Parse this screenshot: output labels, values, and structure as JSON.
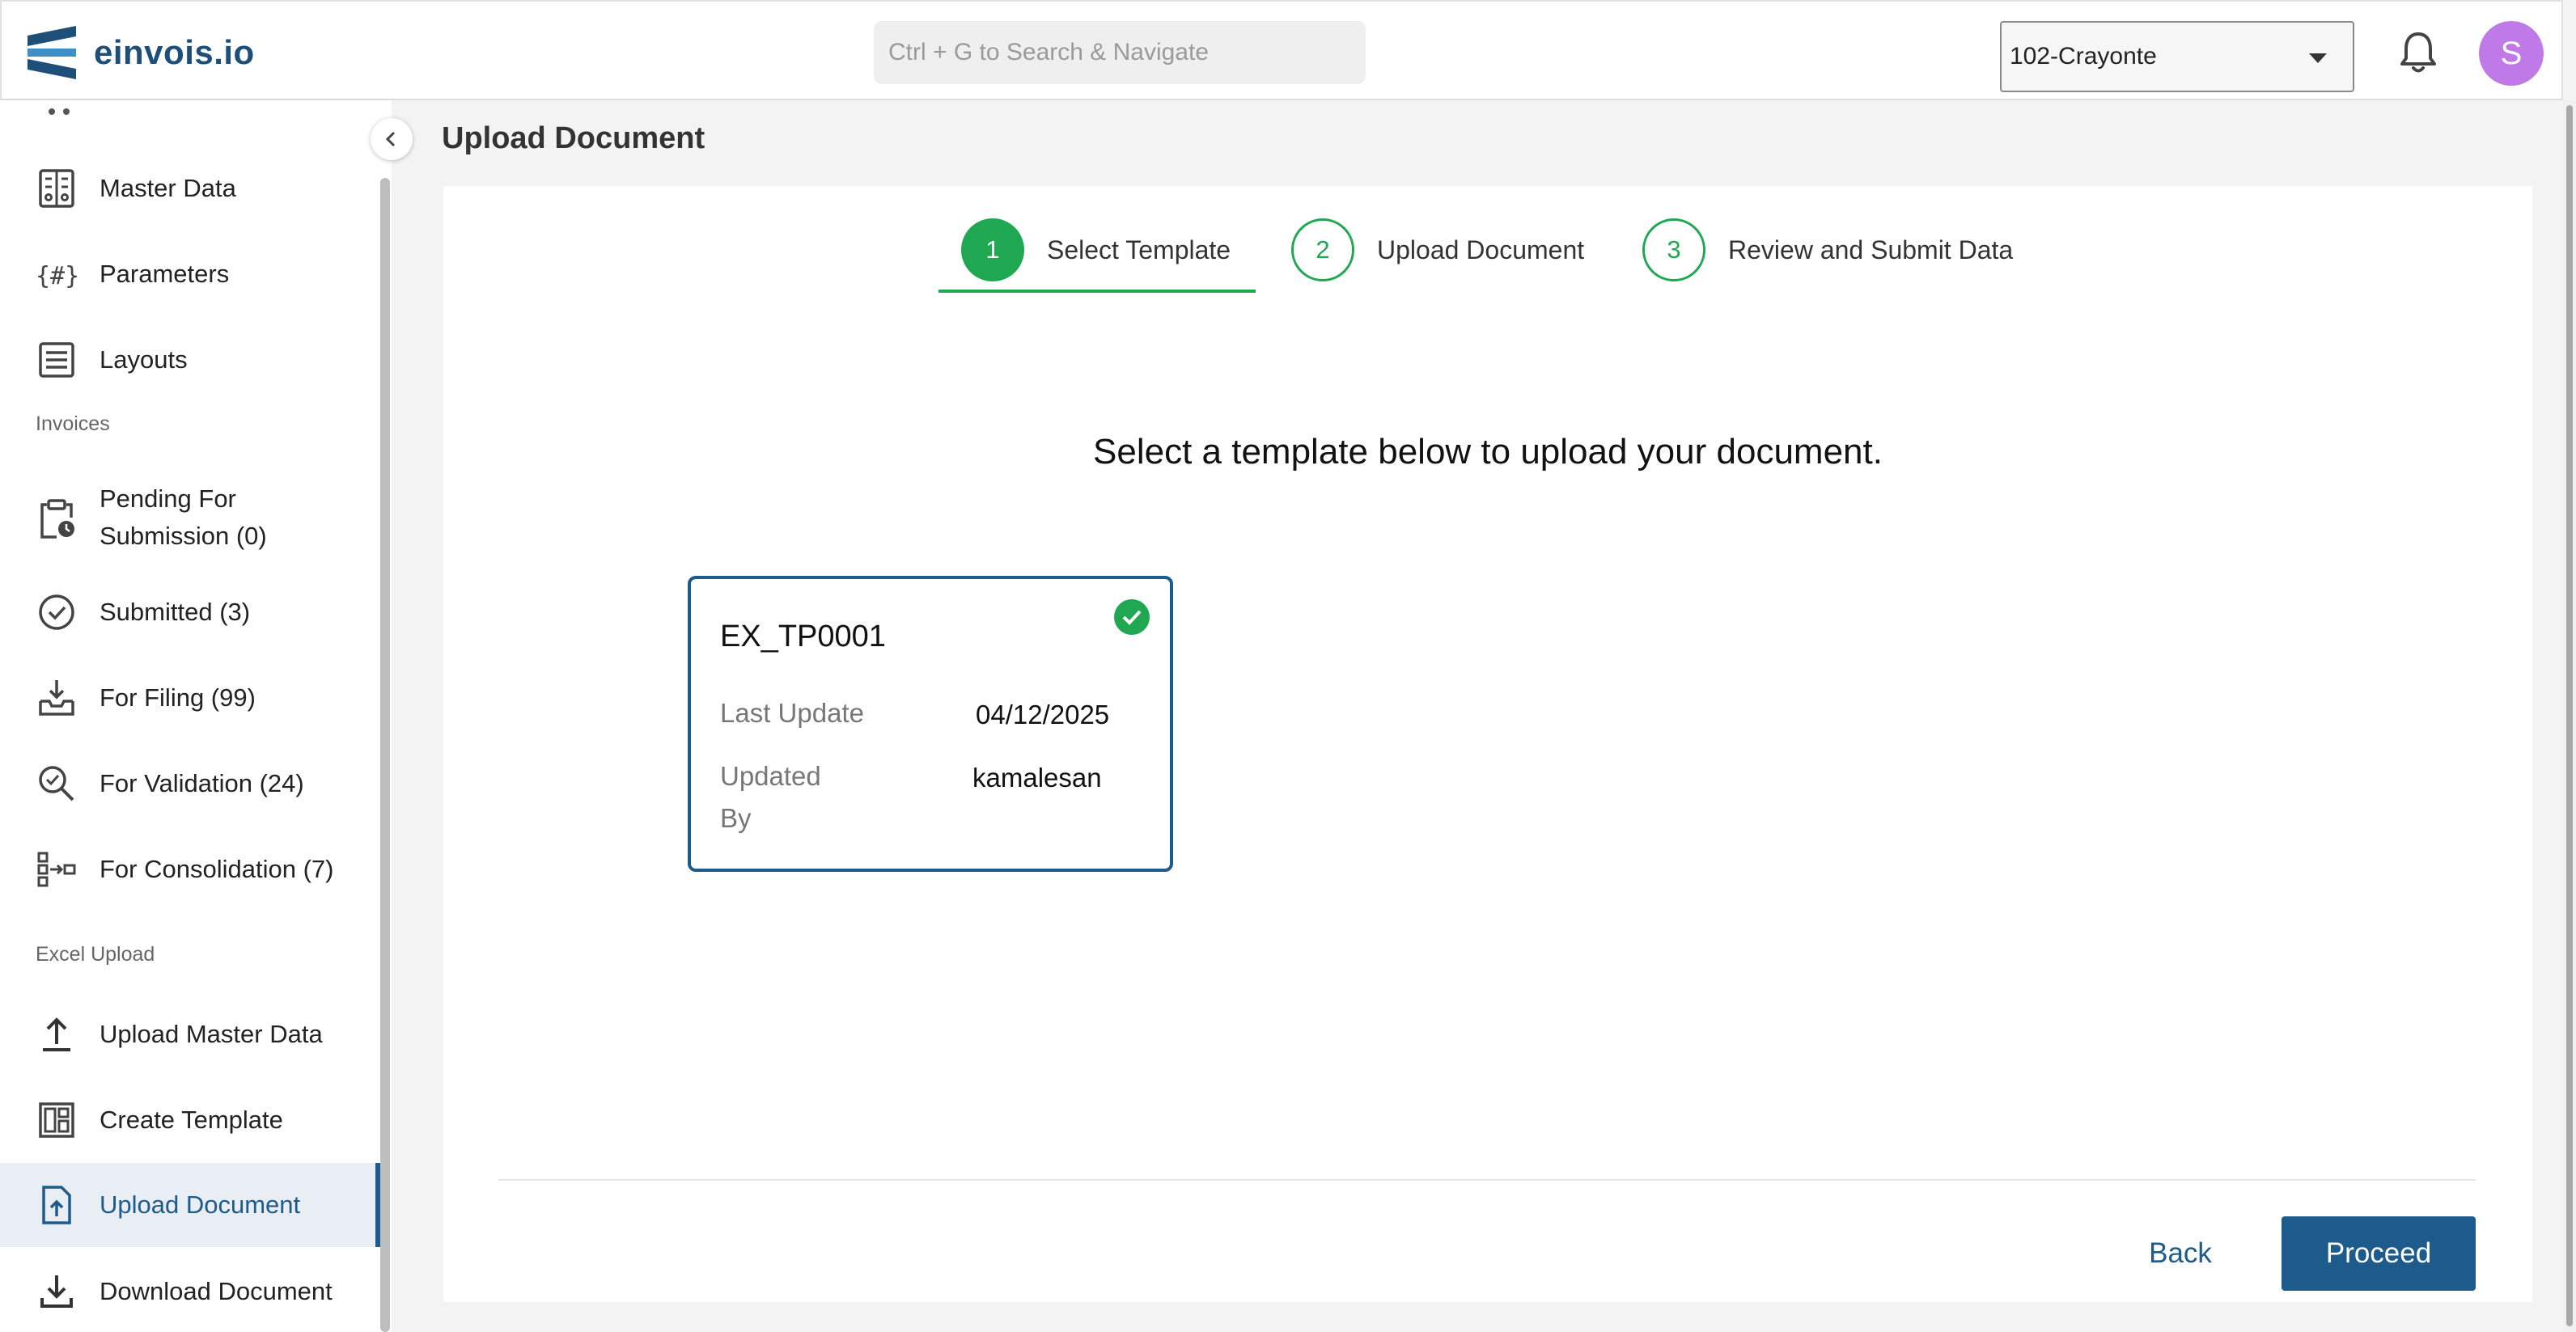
{
  "app": {
    "name": "einvois.io"
  },
  "header": {
    "search_placeholder": "Ctrl + G to Search & Navigate",
    "company_selected": "102-Crayonte",
    "avatar_initial": "S"
  },
  "sidebar": {
    "items_top": [
      {
        "label": "Master Data",
        "icon": "master-data-icon"
      },
      {
        "label": "Parameters",
        "icon": "parameters-icon"
      },
      {
        "label": "Layouts",
        "icon": "layouts-icon"
      }
    ],
    "section_invoices": "Invoices",
    "invoice_items": [
      {
        "label": "Pending For Submission (0)",
        "icon": "pending-clipboard-icon"
      },
      {
        "label": "Submitted (3)",
        "icon": "check-circle-icon"
      },
      {
        "label": "For Filing (99)",
        "icon": "inbox-download-icon"
      },
      {
        "label": "For Validation (24)",
        "icon": "magnify-check-icon"
      },
      {
        "label": "For Consolidation (7)",
        "icon": "consolidation-icon"
      }
    ],
    "section_excel": "Excel Upload",
    "excel_items": [
      {
        "label": "Upload Master Data",
        "icon": "upload-icon"
      },
      {
        "label": "Create Template",
        "icon": "template-icon"
      },
      {
        "label": "Upload Document",
        "icon": "upload-document-icon",
        "active": true
      },
      {
        "label": "Download Document",
        "icon": "download-icon"
      }
    ]
  },
  "main": {
    "page_title": "Upload Document",
    "steps": [
      {
        "number": "1",
        "label": "Select Template",
        "state": "active"
      },
      {
        "number": "2",
        "label": "Upload Document",
        "state": "pending"
      },
      {
        "number": "3",
        "label": "Review and Submit Data",
        "state": "pending"
      }
    ],
    "instruction": "Select a template below to upload your document.",
    "template_card": {
      "name": "EX_TP0001",
      "last_update_label": "Last Update",
      "last_update_value": "04/12/2025",
      "updated_by_label_line1": "Updated",
      "updated_by_label_line2": "By",
      "updated_by_value": "kamalesan",
      "selected": true
    },
    "back_label": "Back",
    "proceed_label": "Proceed"
  },
  "colors": {
    "brand": "#1d5b8c",
    "accent_green": "#1fa851",
    "avatar": "#c07ae8"
  }
}
